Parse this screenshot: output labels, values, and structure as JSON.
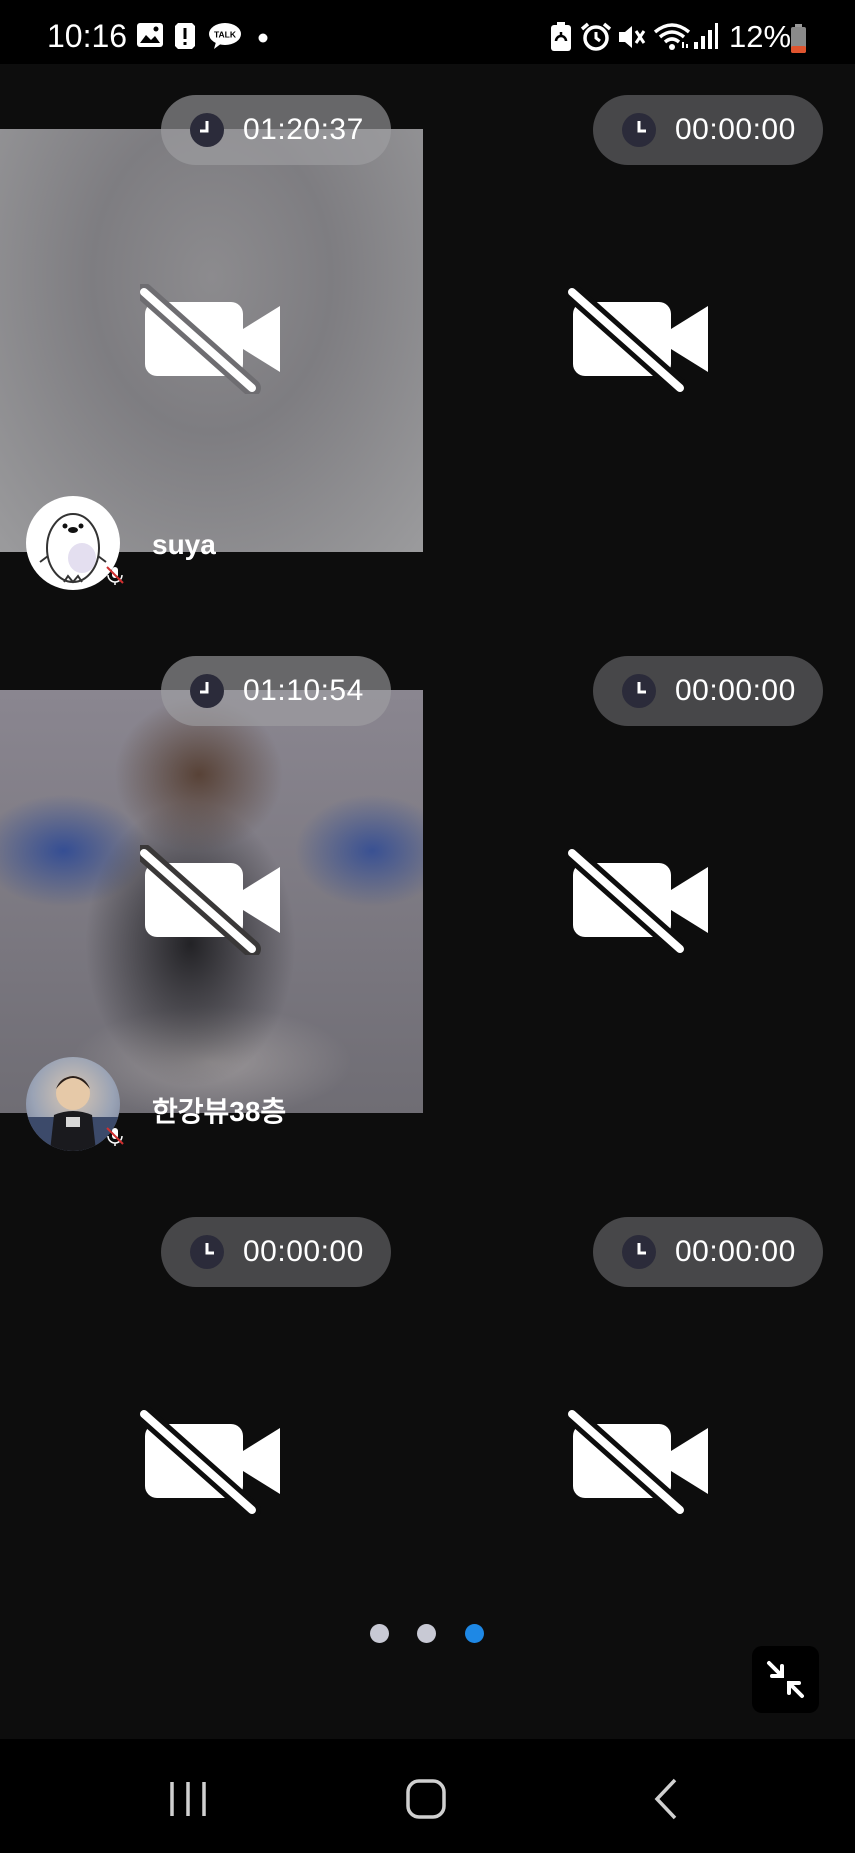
{
  "status_bar": {
    "time": "10:16",
    "battery": "12%",
    "left_icons": [
      "gallery-icon",
      "alert-icon",
      "talk-icon",
      "dot-icon"
    ],
    "right_icons": [
      "battery-saver-icon",
      "alarm-icon",
      "mute-icon",
      "wifi-icon",
      "signal-icon",
      "battery-icon"
    ],
    "talk_badge": "TALK"
  },
  "tiles": [
    {
      "timer": "01:20:37",
      "name": "suya",
      "background": "gray-blur",
      "mic_muted": true,
      "camera_off": true
    },
    {
      "timer": "00:00:00",
      "name": "",
      "camera_off": true
    },
    {
      "timer": "01:10:54",
      "name": "한강뷰38층",
      "background": "photo-blur",
      "mic_muted": true,
      "camera_off": true
    },
    {
      "timer": "00:00:00",
      "name": "",
      "camera_off": true
    },
    {
      "timer": "00:00:00",
      "name": "",
      "camera_off": true
    },
    {
      "timer": "00:00:00",
      "name": "",
      "camera_off": true
    }
  ],
  "pagination": {
    "pages": 3,
    "current": 3
  },
  "colors": {
    "accent": "#1e88e5",
    "battery_low": "#e0542e",
    "pill": "#474749"
  },
  "nav": {
    "buttons": [
      "recents-button",
      "home-button",
      "back-button"
    ]
  }
}
